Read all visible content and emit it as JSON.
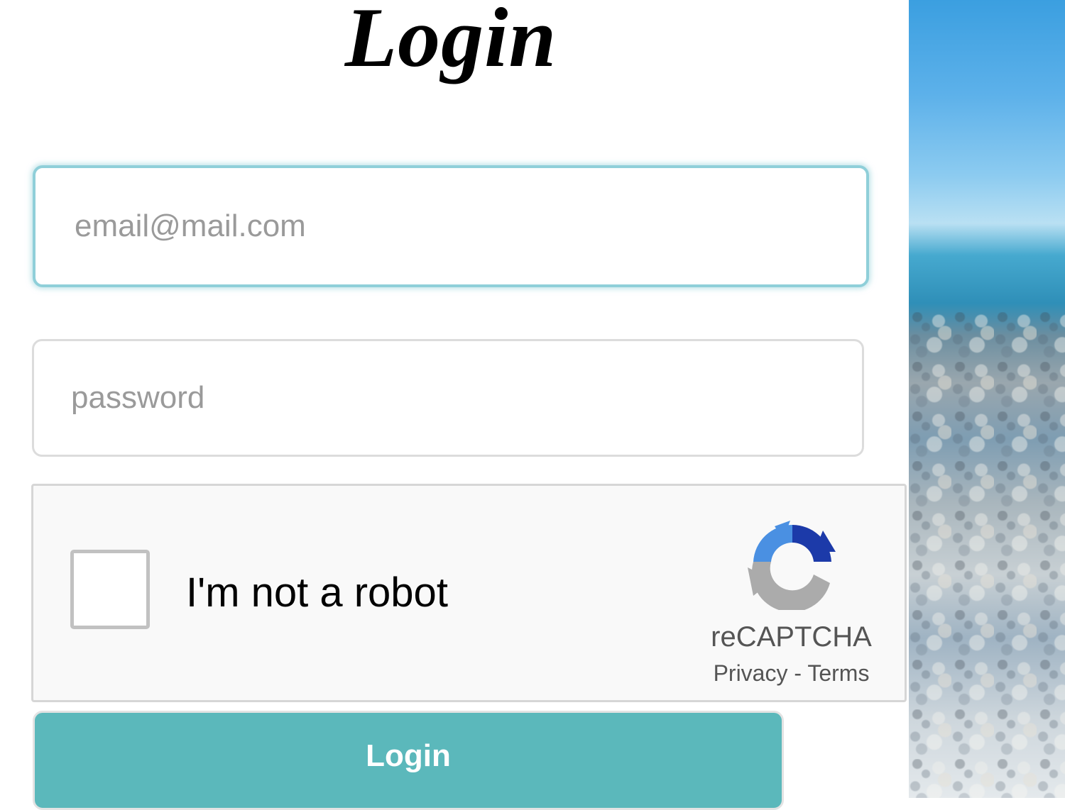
{
  "form": {
    "title": "Login",
    "email_placeholder": "email@mail.com",
    "password_placeholder": "password",
    "login_button_label": "Login"
  },
  "captcha": {
    "label": "I'm not a robot",
    "brand": "reCAPTCHA",
    "privacy_link": "Privacy",
    "separator": "-",
    "terms_link": "Terms",
    "checked": false
  },
  "colors": {
    "button": "#5bb8bb",
    "focus_border": "#8fcfd9",
    "recaptcha_blue_light": "#4a90e2",
    "recaptcha_blue_dark": "#1c3aa9",
    "recaptcha_gray": "#ababab"
  },
  "icons": {
    "captcha_logo": "recaptcha-logo-icon"
  }
}
